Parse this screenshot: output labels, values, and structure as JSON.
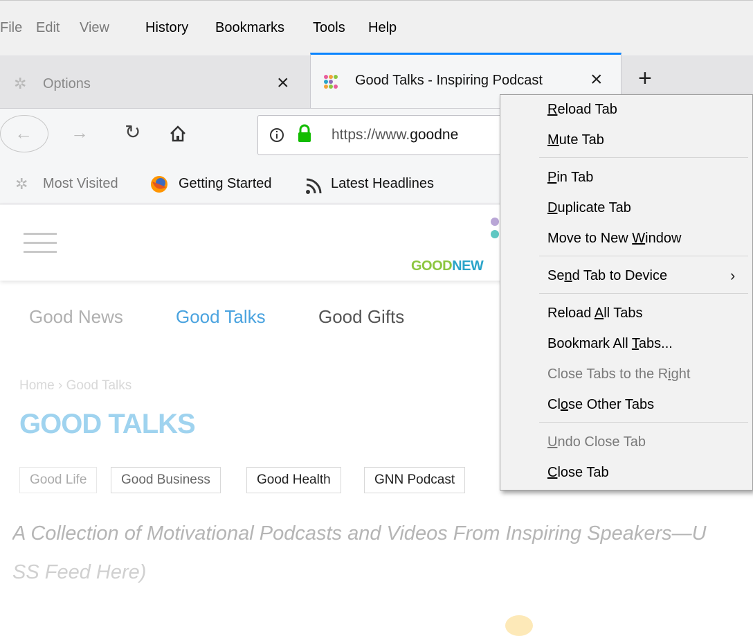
{
  "menubar": {
    "file": "File",
    "edit": "Edit",
    "view": "View",
    "history": "History",
    "bookmarks": "Bookmarks",
    "tools": "Tools",
    "help": "Help"
  },
  "tabs": {
    "options_title": "Options",
    "active_title": "Good Talks - Inspiring Podcast",
    "close_glyph": "×",
    "new_tab_glyph": "+"
  },
  "navbar": {
    "url_prefix": "https://www.",
    "url_domain": "goodne"
  },
  "bookmarks": [
    {
      "label": "Most Visited",
      "icon": "gear-icon"
    },
    {
      "label": "Getting Started",
      "icon": "firefox-icon"
    },
    {
      "label": "Latest Headlines",
      "icon": "rss-icon"
    }
  ],
  "site": {
    "logo_good": "GOOD",
    "logo_news": "NEW",
    "nav": [
      "Good News",
      "Good Talks",
      "Good Gifts"
    ],
    "breadcrumb_home": "Home",
    "breadcrumb_sep": "›",
    "breadcrumb_current": "Good Talks",
    "page_title": "GOOD TALKS",
    "chips": [
      "Good Life",
      "Good Business",
      "Good Health",
      "GNN Podcast"
    ],
    "tagline_line1": "A Collection of Motivational Podcasts and Videos From Inspiring Speakers—U",
    "tagline_line2": "SS Feed Here)"
  },
  "context_menu": {
    "items": [
      {
        "label": "Reload Tab",
        "u": "R",
        "disabled": false
      },
      {
        "label": "Mute Tab",
        "u": "M",
        "disabled": false
      },
      {
        "label": "Pin Tab",
        "u": "P",
        "disabled": false
      },
      {
        "label": "Duplicate Tab",
        "u": "D",
        "disabled": false
      },
      {
        "label": "Move to New Window",
        "u": "W",
        "disabled": false
      },
      {
        "label": "Send Tab to Device",
        "u": "n",
        "disabled": false
      },
      {
        "label": "Reload All Tabs",
        "u": "A",
        "disabled": false
      },
      {
        "label": "Bookmark All Tabs...",
        "u": "T",
        "disabled": false
      },
      {
        "label": "Close Tabs to the Right",
        "u": "i",
        "disabled": true
      },
      {
        "label": "Close Other Tabs",
        "u": "o",
        "disabled": false
      },
      {
        "label": "Undo Close Tab",
        "u": "U",
        "disabled": true
      },
      {
        "label": "Close Tab",
        "u": "C",
        "disabled": false
      }
    ],
    "submenu_arrow": "›"
  },
  "colors": {
    "tab_accent": "#0a84ff",
    "lock_green": "#12bc00",
    "link_blue": "#4aa3df",
    "logo_green": "#8cc63f",
    "logo_blue": "#2aa4c9"
  }
}
